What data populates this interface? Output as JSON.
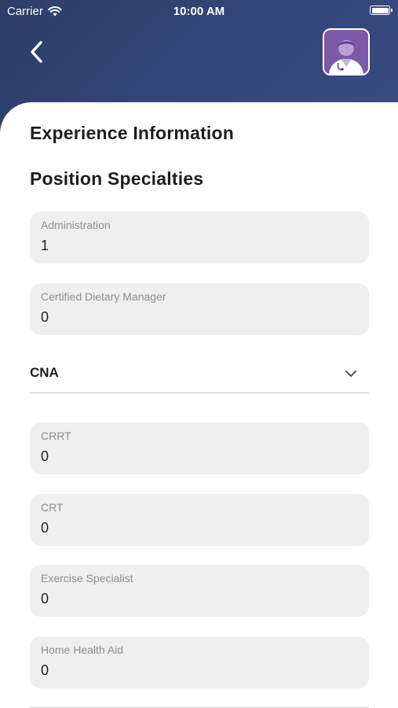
{
  "status_bar": {
    "carrier": "Carrier",
    "time": "10:00 AM"
  },
  "header": {
    "back_icon": "chevron-left-icon",
    "avatar_icon": "nurse-avatar-icon"
  },
  "page": {
    "title": "Experience Information",
    "section_title": "Position Specialties"
  },
  "fields": [
    {
      "label": "Administration",
      "value": "1"
    },
    {
      "label": "Certified Dietary Manager",
      "value": "0"
    },
    {
      "label": "CRRT",
      "value": "0"
    },
    {
      "label": "CRT",
      "value": "0"
    },
    {
      "label": "Exercise Specialist",
      "value": "0"
    },
    {
      "label": "Home Health Aid",
      "value": "0"
    }
  ],
  "dropdown": {
    "label": "CNA",
    "icon": "chevron-down-icon"
  },
  "colors": {
    "header": "#2e3e67",
    "field_bg": "#efefef",
    "avatar_bg": "#7d5aa8"
  }
}
